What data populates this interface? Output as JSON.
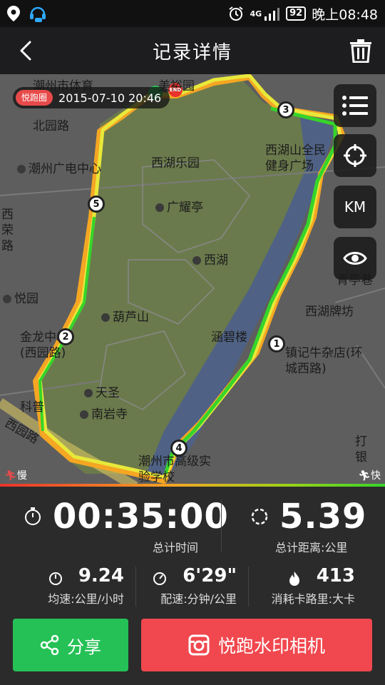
{
  "status_bar": {
    "network": "4G",
    "battery": "92",
    "time": "晚上08:48"
  },
  "header": {
    "title": "记录详情"
  },
  "map": {
    "brand_badge": "悦跑圈",
    "timestamp": "2015-07-10 20:46",
    "end_marker": "END",
    "km_button": "KM",
    "labels": {
      "chaozhou_sports": "潮州市体育",
      "meiyu_garden": "美裕园",
      "beiyuan_road": "北园路",
      "chaozhou_broadcast": "潮州广电中心",
      "xihu_park": "西湖乐园",
      "xihu_fitness": "西湖山全民健身广场",
      "guangyao_pavilion": "广耀亭",
      "xihu": "西湖",
      "west_road": "西荣路",
      "yue_yuan": "悦园",
      "hulu_mountain": "葫芦山",
      "hanbi_tower": "涵碧楼",
      "xihu_archway": "西湖牌坊",
      "jinlong": "金龙中心(西园路)",
      "zhenji": "镇记牛杂店(环城西路)",
      "tiansheng": "天圣",
      "nanyan_temple": "南岩寺",
      "kepu": "科普",
      "xiyuan_road": "西园路",
      "chaozhou_school": "潮州市高级实验学校",
      "qingting_lane": "青亭巷",
      "huancheng": "环城西路",
      "daju": "打银"
    },
    "km_markers": [
      "1",
      "2",
      "3",
      "4",
      "5"
    ],
    "speed_slow": "慢",
    "speed_fast": "快"
  },
  "stats": {
    "total_time": "00:35:00",
    "total_time_label": "总计时间",
    "total_distance": "5.39",
    "total_distance_label": "总计距离:公里",
    "avg_speed": "9.24",
    "avg_speed_label": "均速:公里/小时",
    "pace": "6'29\"",
    "pace_label": "配速:分钟/公里",
    "calories": "413",
    "calories_label": "消耗卡路里:大卡"
  },
  "actions": {
    "share_label": "分享",
    "camera_label": "悦跑水印相机"
  },
  "colors": {
    "share_green": "#25c156",
    "camera_red": "#f0484e",
    "route_green": "#36d52a",
    "route_orange": "#f5a623",
    "route_yellow": "#e8e83a"
  }
}
